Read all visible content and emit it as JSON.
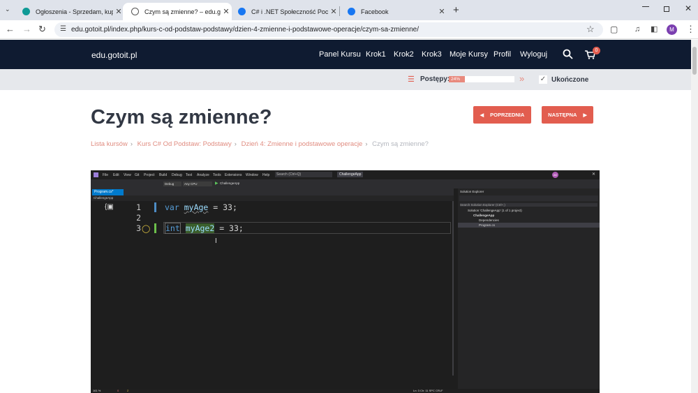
{
  "browser": {
    "tabs": [
      {
        "title": "Ogłoszenia - Sprzedam, kupię n",
        "active": false,
        "favicon": "olx-icon"
      },
      {
        "title": "Czym są zmienne? – edu.gotoit",
        "active": true,
        "favicon": "globe-icon"
      },
      {
        "title": "C# i .NET Społeczność Początk",
        "active": false,
        "favicon": "facebook-icon"
      },
      {
        "title": "Facebook",
        "active": false,
        "favicon": "facebook-icon"
      }
    ],
    "new_tab": "+",
    "url": "edu.gotoit.pl/index.php/kurs-c-od-podstaw-podstawy/dzien-4-zmienne-i-podstawowe-operacje/czym-sa-zmienne/",
    "profile_initial": "M"
  },
  "site": {
    "logo": "edu.gotoit.pl",
    "menu": [
      "Panel Kursu",
      "Krok1",
      "Krok2",
      "Krok3",
      "Moje Kursy",
      "Profil",
      "Wyloguj"
    ],
    "cart_count": "0"
  },
  "progress": {
    "label": "Postępy:",
    "percent_text": "24%",
    "percent": 24,
    "completed_label": "Ukończone"
  },
  "lesson": {
    "title": "Czym są zmienne?",
    "prev_label": "POPRZEDNIA",
    "next_label": "NASTĘPNA",
    "breadcrumb": [
      "Lista kursów",
      "Kurs C# Od Podstaw: Podstawy",
      "Dzień 4: Zmienne i podstawowe operacje",
      "Czym są zmienne?"
    ]
  },
  "video": {
    "menu": [
      "File",
      "Edit",
      "View",
      "Git",
      "Project",
      "Build",
      "Debug",
      "Test",
      "Analyze",
      "Tools",
      "Extensions",
      "Window",
      "Help"
    ],
    "search": "Search (Ctrl+Q)",
    "app_name": "ChallengeApp",
    "user_initials": "AK",
    "toolbar_config": "Debug",
    "toolbar_platform": "Any CPU",
    "toolbar_run": "ChallengeApp",
    "file_tab": "Program.cs*",
    "project_dropdown": "ChallengeApp",
    "code": [
      {
        "num": "1",
        "kw": "var",
        "id": "myAge",
        "rest": " = 33;"
      },
      {
        "num": "2",
        "kw": "",
        "id": "",
        "rest": ""
      },
      {
        "num": "3",
        "kw": "int",
        "id": "myAge2",
        "rest": " = 33;"
      }
    ],
    "solution_explorer": {
      "title": "Solution Explorer",
      "search": "Search Solution Explorer (Ctrl+;)",
      "items": [
        "Solution 'ChallengeApp' (1 of 1 project)",
        "ChallengeApp",
        "Dependencies",
        "Program.cs"
      ]
    },
    "status": {
      "zoom": "161 %",
      "errors": "0",
      "warnings": "2",
      "position": "Ln: 3   Ch: 11   SPC   CRLF"
    }
  }
}
